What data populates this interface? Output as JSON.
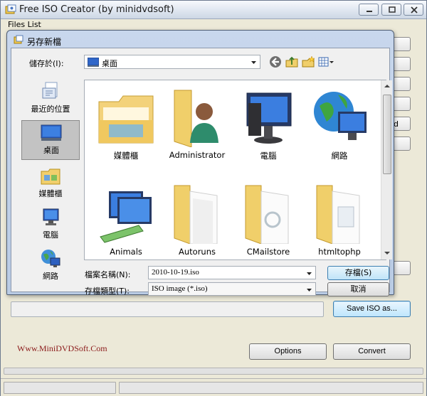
{
  "window": {
    "title": "Free ISO Creator (by minidvdsoft)"
  },
  "menu": {
    "files_list": "Files List"
  },
  "side_buttons": [
    "",
    "",
    "",
    "",
    "d",
    ""
  ],
  "buttons": {
    "save_iso_as": "Save ISO as...",
    "options": "Options",
    "convert": "Convert"
  },
  "footer": {
    "site": "Www.MiniDVDSoft.Com"
  },
  "dialog": {
    "title": "另存新檔",
    "save_in_label": "儲存於(I):",
    "save_in_value": "桌面",
    "places": [
      {
        "label": "最近的位置",
        "icon": "recent-places-icon"
      },
      {
        "label": "桌面",
        "icon": "desktop-icon"
      },
      {
        "label": "媒體櫃",
        "icon": "libraries-icon"
      },
      {
        "label": "電腦",
        "icon": "computer-icon"
      },
      {
        "label": "網路",
        "icon": "network-icon"
      }
    ],
    "files": [
      {
        "label": "媒體櫃",
        "icon": "libraries-folder-icon"
      },
      {
        "label": "Administrator",
        "icon": "user-folder-icon"
      },
      {
        "label": "電腦",
        "icon": "computer-icon"
      },
      {
        "label": "網路",
        "icon": "network-icon"
      },
      {
        "label": "Animals",
        "icon": "network-folder-icon"
      },
      {
        "label": "Autoruns",
        "icon": "folder-icon"
      },
      {
        "label": "CMailstore",
        "icon": "folder-icon"
      },
      {
        "label": "htmltophp",
        "icon": "folder-icon"
      }
    ],
    "filename_label": "檔案名稱(N):",
    "filename_value": "2010-10-19.iso",
    "filetype_label": "存檔類型(T):",
    "filetype_value": "ISO image (*.iso)",
    "save_button": "存檔(S)",
    "cancel_button": "取消"
  }
}
